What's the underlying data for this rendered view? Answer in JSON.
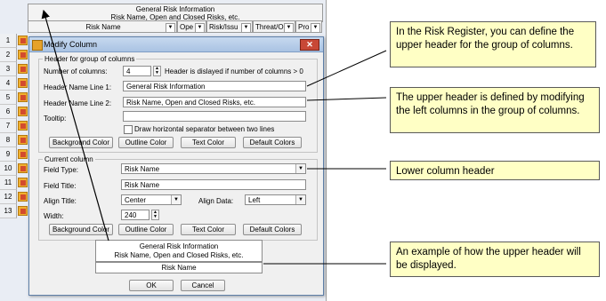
{
  "sheet": {
    "top_header_line1": "General Risk Information",
    "top_header_line2": "Risk Name, Open and Closed Risks, etc.",
    "columns": [
      "Risk Name",
      "Ope",
      "Risk/Issu",
      "Threat/O",
      "Pro"
    ],
    "rows": [
      "1",
      "2",
      "3",
      "4",
      "5",
      "6",
      "7",
      "8",
      "9",
      "10",
      "11",
      "12",
      "13"
    ]
  },
  "dialog": {
    "title": "Modify Column",
    "close_label": "✕",
    "group_header": {
      "legend": "Header for group of columns",
      "num_columns_label": "Number of columns:",
      "num_columns_value": "4",
      "num_columns_note": "Header is dislayed if number of columns > 0",
      "line1_label": "Header Name Line 1:",
      "line1_value": "General Risk Information",
      "line2_label": "Header Name Line 2:",
      "line2_value": "Risk Name, Open and Closed Risks, etc.",
      "tooltip_label": "Tooltip:",
      "tooltip_value": "",
      "separator_label": "Draw horizontal separator between two lines",
      "buttons": [
        "Background Color",
        "Outline Color",
        "Text Color",
        "Default Colors"
      ]
    },
    "current_column": {
      "legend": "Current column",
      "field_type_label": "Field Type:",
      "field_type_value": "Risk Name",
      "field_title_label": "Field Title:",
      "field_title_value": "Risk Name",
      "align_title_label": "Align Title:",
      "align_title_value": "Center",
      "align_data_label": "Align Data:",
      "align_data_value": "Left",
      "width_label": "Width:",
      "width_value": "240",
      "buttons": [
        "Background Color",
        "Outline Color",
        "Text Color",
        "Default Colors"
      ]
    },
    "preview": {
      "line1": "General Risk Information",
      "line2": "Risk Name, Open and Closed Risks, etc.",
      "lower": "Risk Name"
    },
    "ok_label": "OK",
    "cancel_label": "Cancel"
  },
  "callouts": [
    "In the Risk Register, you can define the upper header for the group of columns.",
    "The upper header is defined by modifying the left columns in the group of columns.",
    "Lower column header",
    "An example of how the upper header will be displayed."
  ]
}
